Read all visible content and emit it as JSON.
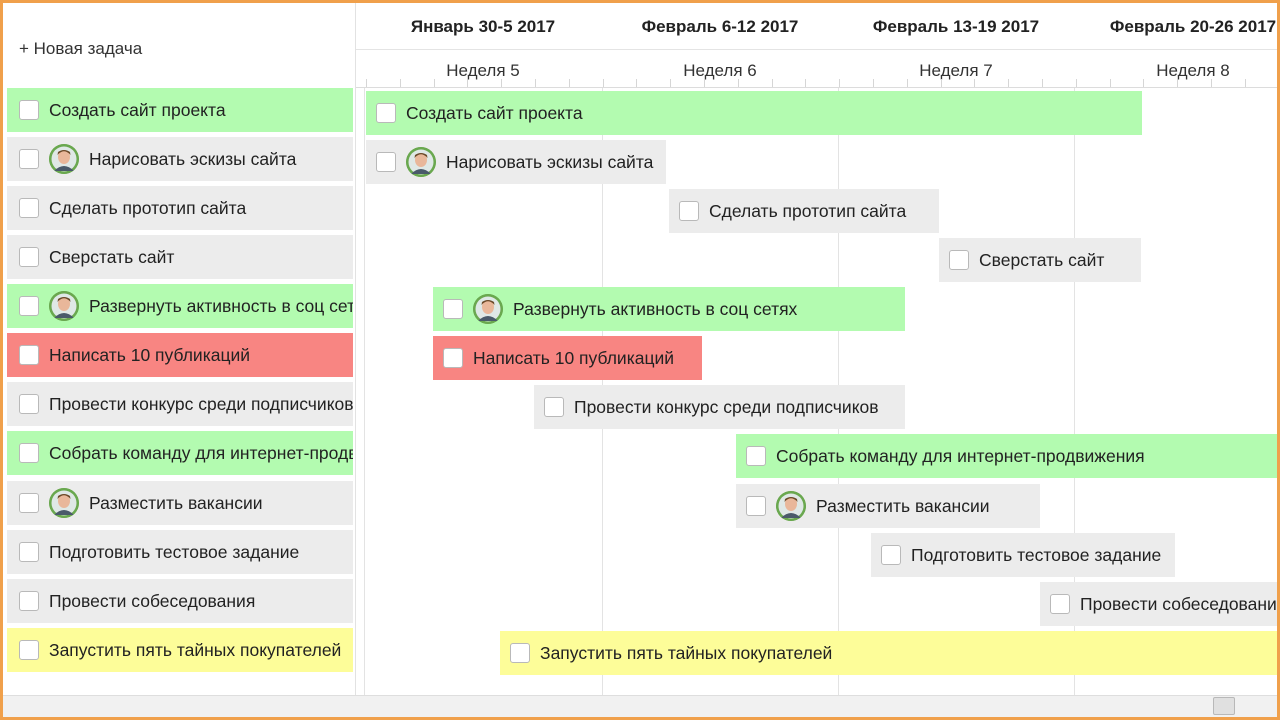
{
  "toolbar": {
    "new_task_label": "+ Новая задача"
  },
  "header": {
    "weeks": [
      "Январь 30-5 2017",
      "Февраль 6-12 2017",
      "Февраль 13-19 2017",
      "Февраль 20-26 2017"
    ],
    "week_numbers": [
      "Неделя 5",
      "Неделя 6",
      "Неделя 7",
      "Неделя 8"
    ]
  },
  "colors": {
    "green": "#b3fbb0",
    "gray": "#ececec",
    "red": "#f88582",
    "yellow": "#fdfd99",
    "frame": "#f0a04b"
  },
  "tasks": [
    {
      "label": "Создать сайт проекта",
      "color": "green",
      "avatar": false
    },
    {
      "label": "Нарисовать эскизы сайта",
      "color": "gray",
      "avatar": true
    },
    {
      "label": "Сделать прототип сайта",
      "color": "gray",
      "avatar": false
    },
    {
      "label": "Сверстать сайт",
      "color": "gray",
      "avatar": false
    },
    {
      "label": "Развернуть активность в соц сетях",
      "color": "green",
      "avatar": true
    },
    {
      "label": "Написать 10 публикаций",
      "color": "red",
      "avatar": false
    },
    {
      "label": "Провести конкурс среди подписчиков",
      "color": "gray",
      "avatar": false
    },
    {
      "label": "Собрать команду для интернет-продвижения",
      "color": "green",
      "avatar": false
    },
    {
      "label": "Разместить вакансии",
      "color": "gray",
      "avatar": true
    },
    {
      "label": "Подготовить тестовое задание",
      "color": "gray",
      "avatar": false
    },
    {
      "label": "Провести собеседования",
      "color": "gray",
      "avatar": false
    },
    {
      "label": "Запустить пять тайных покупателей",
      "color": "yellow",
      "avatar": false
    }
  ]
}
